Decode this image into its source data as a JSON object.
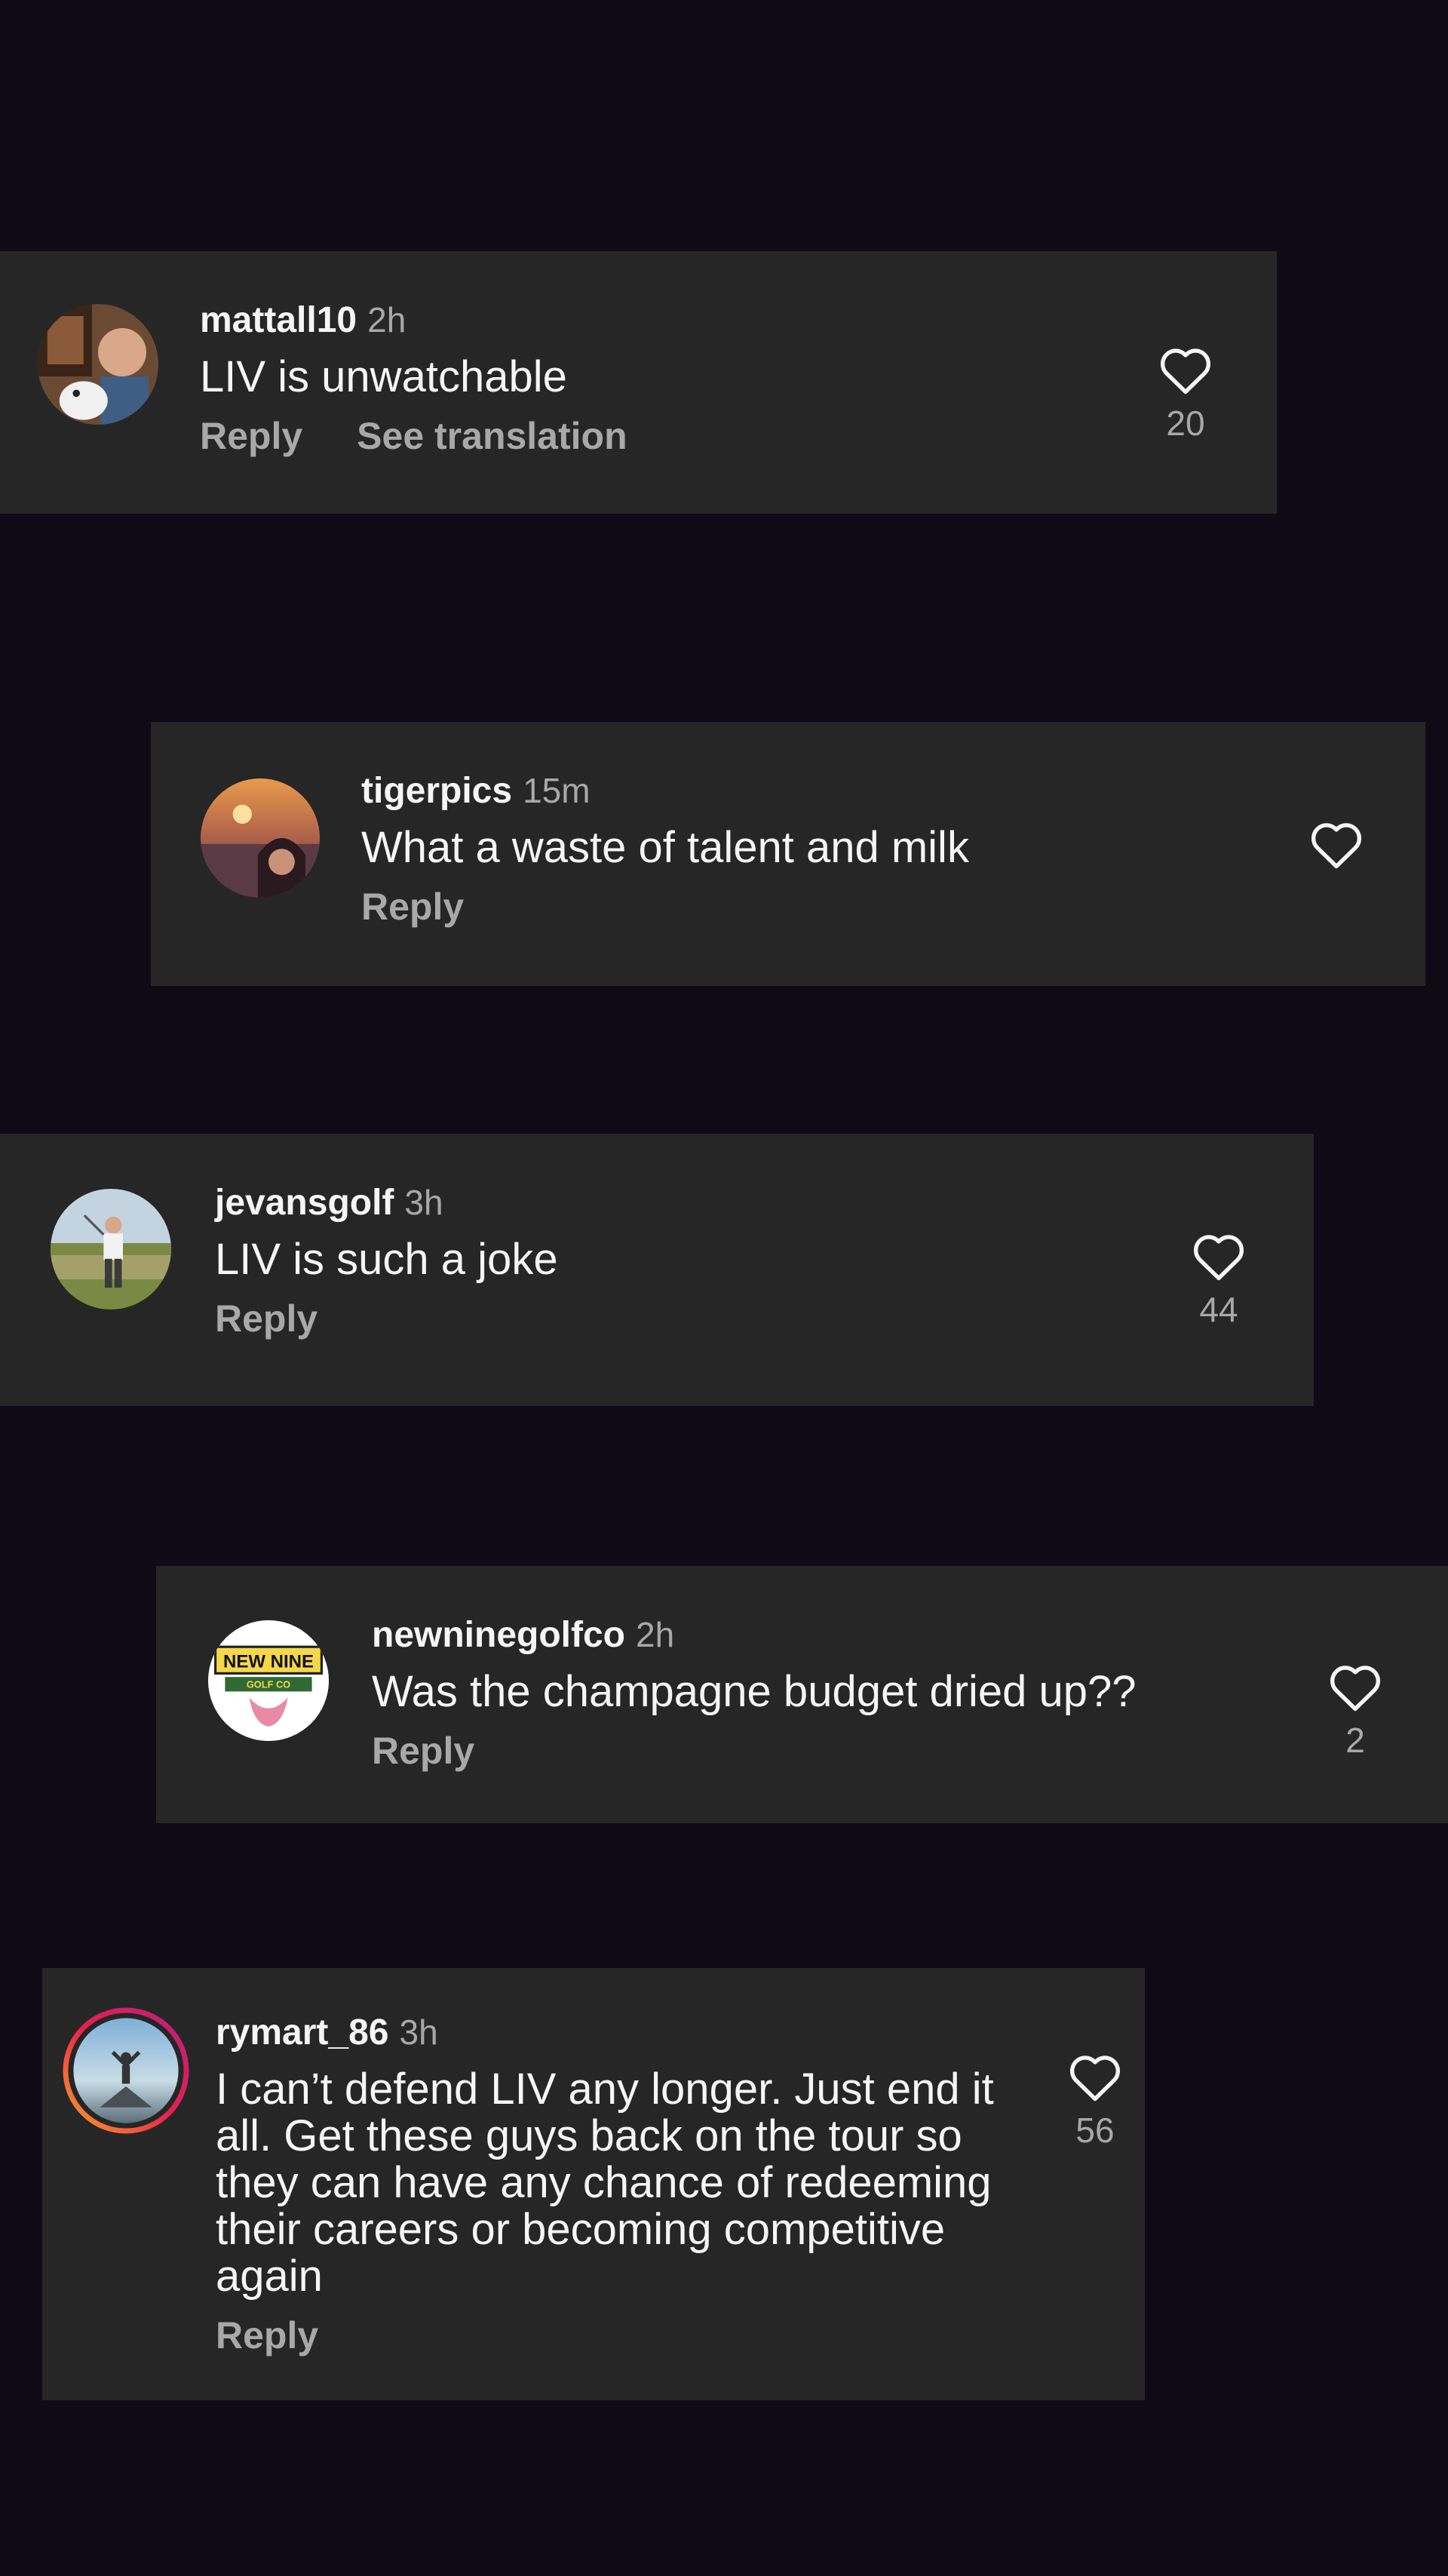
{
  "comments": [
    {
      "username": "mattall10",
      "time": "2h",
      "text": "LIV is unwatchable",
      "reply_label": "Reply",
      "translation_label": "See translation",
      "likes": "20"
    },
    {
      "username": "tigerpics",
      "time": "15m",
      "text": "What a waste of talent and milk",
      "reply_label": "Reply",
      "likes": ""
    },
    {
      "username": "jevansgolf",
      "time": "3h",
      "text": "LIV is such a joke",
      "reply_label": "Reply",
      "likes": "44"
    },
    {
      "username": "newninegolfco",
      "time": "2h",
      "text": "Was the champagne budget dried up??",
      "reply_label": "Reply",
      "likes": "2",
      "avatar_logo_line1": "NEW NINE",
      "avatar_logo_line2": "GOLF CO"
    },
    {
      "username": "rymart_86",
      "time": "3h",
      "text": "I can’t defend LIV any longer. Just end it all. Get these guys back on the tour so they can have any chance of redeeming their careers or becoming competitive again",
      "reply_label": "Reply",
      "likes": "56"
    }
  ],
  "colors": {
    "background": "#0f0a16",
    "card": "#262626",
    "primary_text": "#f5f5f5",
    "secondary_text": "#a8a8a8"
  },
  "icons": {
    "like": "heart-outline-icon"
  }
}
